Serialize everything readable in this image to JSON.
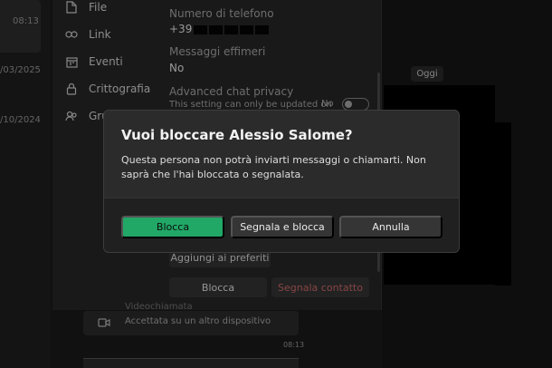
{
  "left_strip": {
    "time": "08:13",
    "date1": "/03/2025",
    "date2": "/10/2024"
  },
  "nav": {
    "items": [
      {
        "label": "File",
        "icon": "file-icon"
      },
      {
        "label": "Link",
        "icon": "link-icon"
      },
      {
        "label": "Eventi",
        "icon": "calendar-icon"
      },
      {
        "label": "Crittografia",
        "icon": "lock-icon"
      },
      {
        "label": "Gru",
        "icon": "group-icon"
      }
    ]
  },
  "info": {
    "phone_label": "Numero di telefono",
    "phone_prefix": "+39",
    "ephemeral_label": "Messaggi effimeri",
    "ephemeral_value": "No",
    "privacy_label": "Advanced chat privacy",
    "privacy_note": "This setting can only be updated on",
    "privacy_value": "No"
  },
  "actions": {
    "favorites": "Aggiungi ai preferiti",
    "block": "Blocca",
    "report": "Segnala contatto"
  },
  "chat": {
    "today": "Oggi",
    "video_title": "Videochiamata",
    "video_subtitle": "Accettata su un altro dispositivo",
    "video_time": "08:13"
  },
  "dialog": {
    "title": "Vuoi bloccare Alessio Salome?",
    "body": "Questa persona non potrà inviarti messaggi o chiamarti. Non saprà che l'hai bloccata o segnalata.",
    "btn_block": "Blocca",
    "btn_report_block": "Segnala e blocca",
    "btn_cancel": "Annulla"
  },
  "colors": {
    "accent": "#21a867",
    "report": "#d06a6a"
  }
}
